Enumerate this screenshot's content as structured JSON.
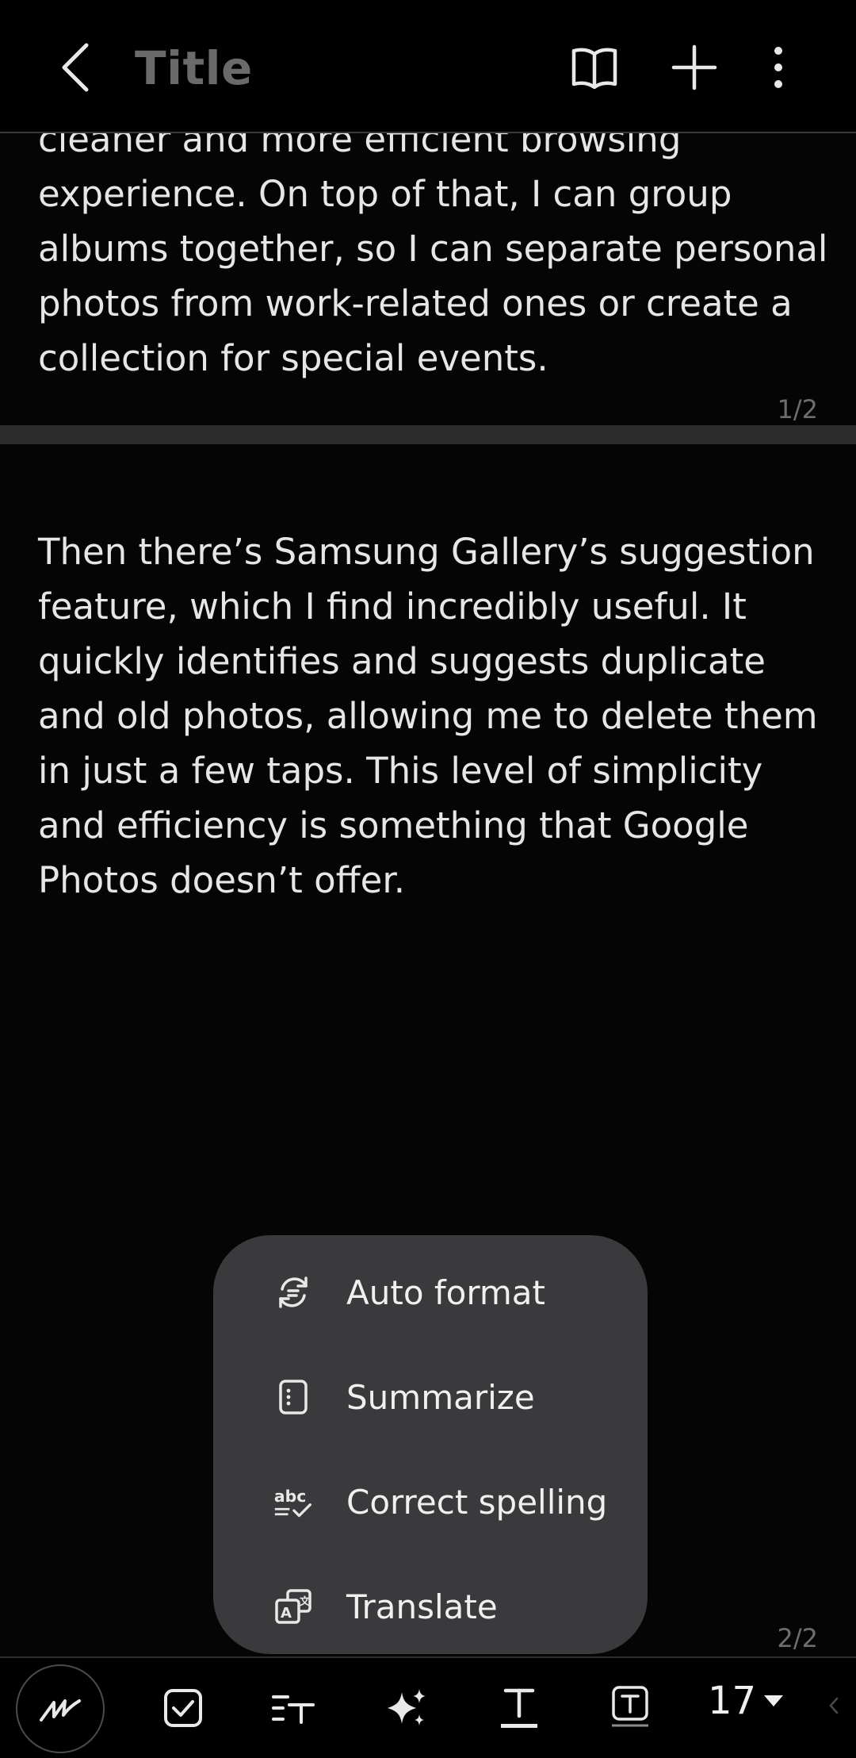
{
  "header": {
    "title": "Title"
  },
  "pages": [
    {
      "text": "cleaner and more efficient browsing experience. On top of that, I can group albums together, so I can separate personal photos from work-related ones or create a collection for special events.",
      "page_number": "1/2"
    },
    {
      "text": "Then there’s Samsung Gallery’s suggestion feature, which I find incredibly useful. It quickly identifies and suggests duplicate and old photos, allowing me to delete them in just a few taps. This level of simplicity and efficiency is something that Google Photos doesn’t offer.",
      "page_number": "2/2"
    }
  ],
  "ai_menu": {
    "items": [
      {
        "label": "Auto format",
        "icon": "auto-format-icon"
      },
      {
        "label": "Summarize",
        "icon": "summarize-icon"
      },
      {
        "label": "Correct spelling",
        "icon": "spell-check-icon"
      },
      {
        "label": "Translate",
        "icon": "translate-icon"
      }
    ]
  },
  "toolbar": {
    "font_size": "17"
  },
  "colors": {
    "background": "#000000",
    "popup": "#3a3a3c",
    "text": "#e6e6e6",
    "title": "#6a6a6a",
    "separator": "#2b2b2b"
  }
}
